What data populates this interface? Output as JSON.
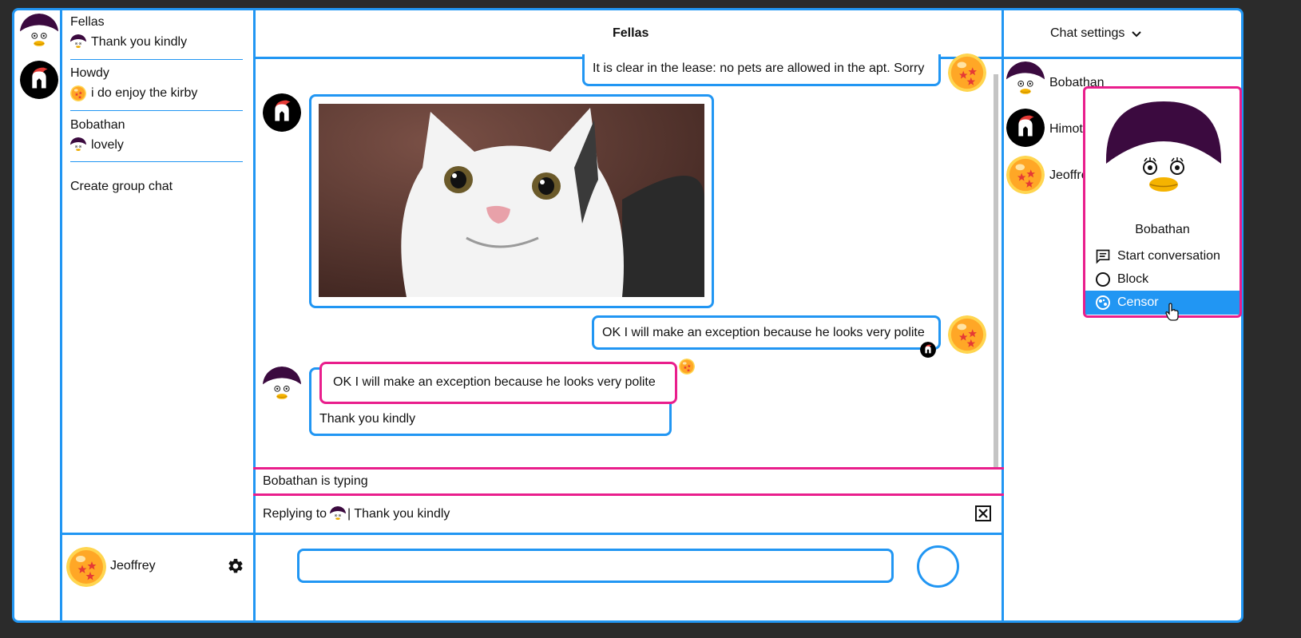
{
  "left_rail": {
    "avatars": [
      "penguin-avatar",
      "spartan-avatar"
    ]
  },
  "chats": [
    {
      "name": "Fellas",
      "preview_avatar": "penguin",
      "preview": "Thank you kindly"
    },
    {
      "name": "Howdy",
      "preview_avatar": "dragonball",
      "preview": "i do enjoy the kirby"
    },
    {
      "name": "Bobathan",
      "preview_avatar": "penguin",
      "preview": "lovely"
    }
  ],
  "create_group": "Create group chat",
  "current_user": {
    "name": "Jeoffrey"
  },
  "header": {
    "title": "Fellas",
    "settings_label": "Chat settings"
  },
  "messages": {
    "m1": "It is clear in the lease: no pets are allowed in the apt. Sorry",
    "m3": "OK I will make an exception because he looks very polite",
    "reply_quote": "OK I will make an exception because he looks very polite",
    "m4": "Thank you kindly"
  },
  "typing": "Bobathan is typing",
  "reply_bar": {
    "prefix": "Replying to",
    "text": "| Thank you kindly"
  },
  "members": [
    "Bobathan",
    "Himot",
    "Jeoffre"
  ],
  "popup": {
    "name": "Bobathan",
    "items": [
      "Start conversation",
      "Block",
      "Censor"
    ]
  },
  "colors": {
    "accent": "#2196f3",
    "highlight": "#e91e8c",
    "penguin_hat": "#3b0a3f",
    "beak": "#f5b300"
  }
}
